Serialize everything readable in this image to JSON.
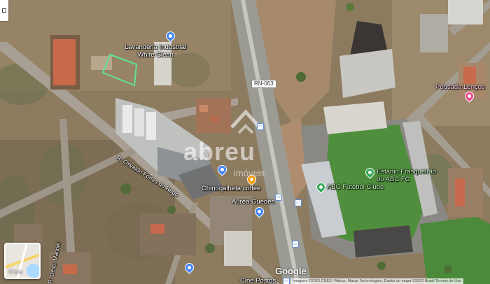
{
  "map": {
    "type": "satellite",
    "base_color": "#8a7a62",
    "places": [
      {
        "name": "Lavanderia Industrial\nWhite Clean",
        "line1": "Lavanderia Industrial",
        "line2": "White Clean",
        "icon": "shopping-pin-icon",
        "color": "#4285f4"
      },
      {
        "name": "Pousada Lenços",
        "icon": "lodging-pin-icon",
        "color": "#e94d8b"
      },
      {
        "name": "Estádio Frasqueirão",
        "line1": "Estádio Frasqueirão",
        "line2": "do ABC FC",
        "icon": "stadium-pin-icon",
        "color": "#34a853"
      },
      {
        "name": "ABC Futebol Clube",
        "icon": "sports-pin-icon",
        "color": "#34a853"
      },
      {
        "name": "Chinoqalheta coffee",
        "icon": "cafe-pin-icon",
        "color": "#f29900"
      },
      {
        "name": "Aurea Guedes",
        "icon": "building-pin-icon",
        "color": "#4285f4"
      },
      {
        "name": "Cine Postos",
        "icon": "store-pin-icon",
        "color": "#4285f4"
      }
    ],
    "streets": [
      {
        "name": "R. Osvaldo Fortes do Rego"
      },
      {
        "name": "R. Desp. Manoel"
      }
    ],
    "route_shield": "RN-063",
    "highlight_color": "#5fe39a"
  },
  "watermark": {
    "brand": "abreu",
    "sub": "imóveis"
  },
  "controls": {
    "layer_toggle_label": "Mapa",
    "fullscreen": "fullscreen-icon"
  },
  "footer": {
    "logo": "Google",
    "attribution": "Imagens ©2020 CNES / Airbus, Maxar Technologies, Dados do mapa ©2020   Brasil   Termos de Uso"
  }
}
